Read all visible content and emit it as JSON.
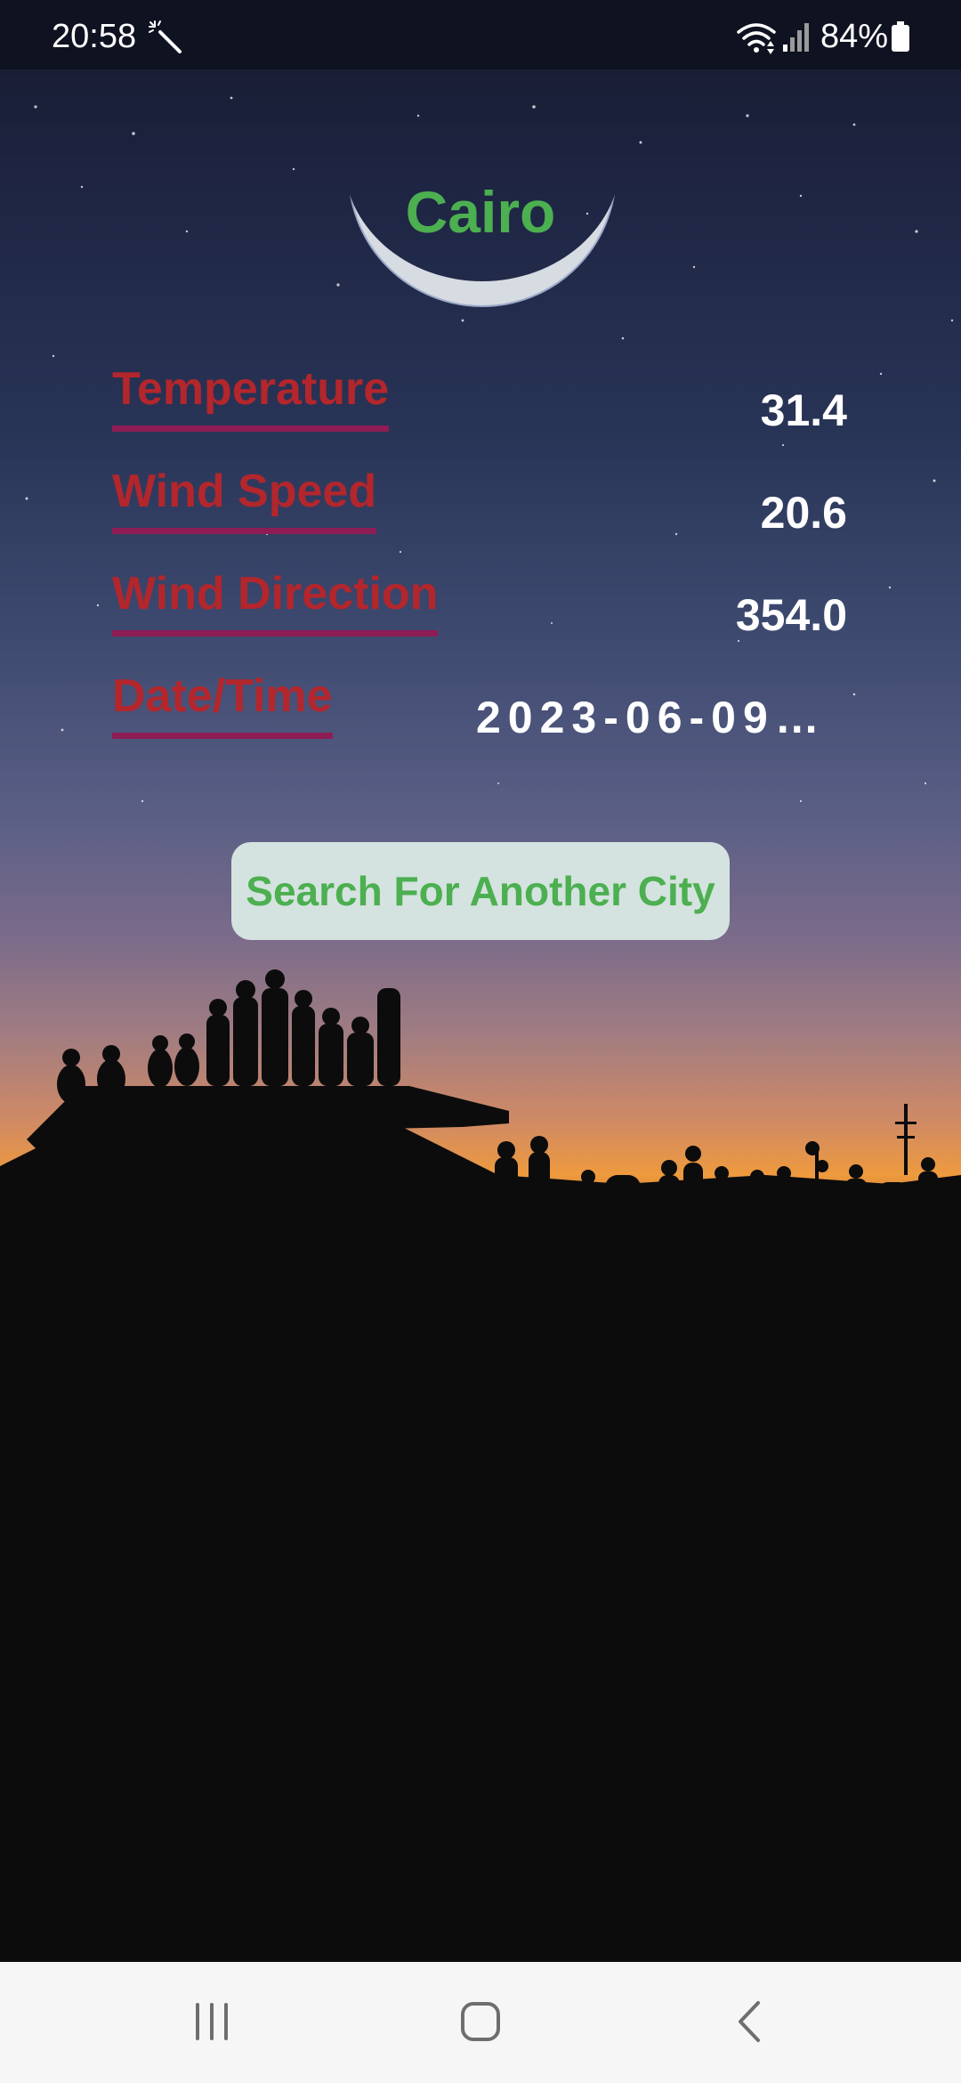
{
  "status_bar": {
    "time": "20:58",
    "battery": "84%",
    "icons": [
      "wand-icon",
      "wifi-icon",
      "signal-icon",
      "battery-icon"
    ]
  },
  "city": "Cairo",
  "weather": {
    "temperature_label": "Temperature",
    "temperature_value": "31.4",
    "wind_speed_label": "Wind Speed",
    "wind_speed_value": "20.6",
    "wind_direction_label": "Wind Direction",
    "wind_direction_value": "354.0",
    "datetime_label": "Date/Time",
    "datetime_value": "2023-06-09..."
  },
  "search_button_label": "Search For Another City",
  "nav_bar": {
    "icons": [
      "recent-apps-icon",
      "home-icon",
      "back-icon"
    ]
  },
  "colors": {
    "title_green": "#4caf50",
    "label_red": "#b3262c",
    "underline": "#8e1c55",
    "button_bg": "#d4e3df",
    "nav_bg": "#f6f6f6"
  }
}
